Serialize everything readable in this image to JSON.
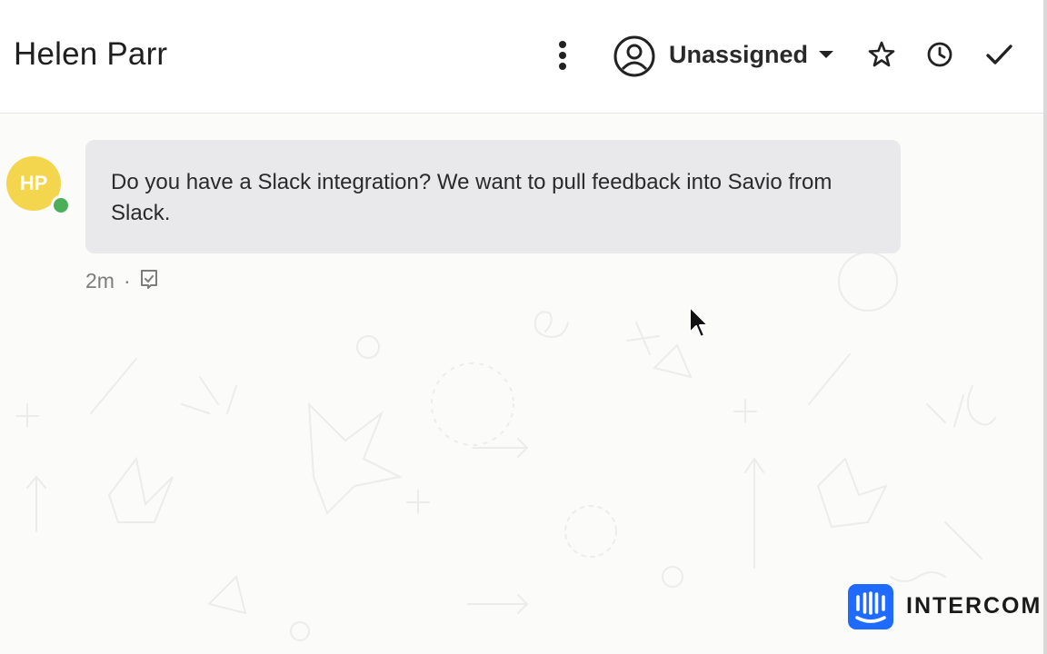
{
  "conversation": {
    "title": "Helen Parr"
  },
  "toolbar": {
    "more_icon": "more-vertical-icon",
    "assignee_label": "Unassigned",
    "assignee_icon": "user-circle-icon",
    "dropdown_icon": "caret-down-icon",
    "star_icon": "star-icon",
    "snooze_icon": "clock-icon",
    "close_icon": "check-icon"
  },
  "message": {
    "author_initials": "HP",
    "avatar_color": "#f3d64d",
    "online_status_color": "#4caf58",
    "text": "Do you have a Slack integration? We want to pull feedback into Savio from Slack.",
    "time": "2m",
    "separator": "·",
    "seen_icon": "seen-icon"
  },
  "branding": {
    "wordmark": "INTERCOM",
    "logo_color": "#1f6bff"
  }
}
